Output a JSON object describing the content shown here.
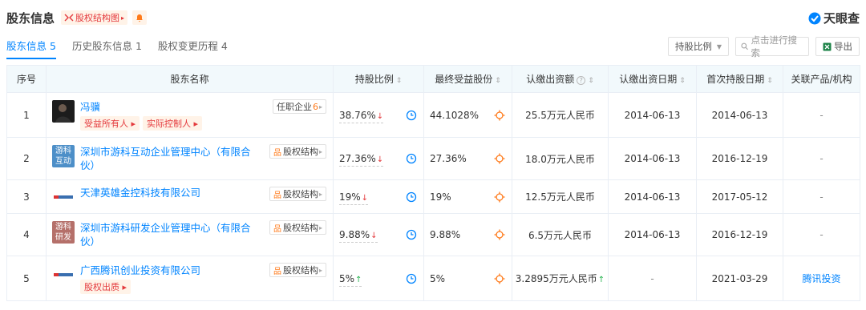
{
  "header": {
    "title": "股东信息",
    "equity_chart_label": "股权结构图",
    "brand": "天眼查"
  },
  "tabs": [
    {
      "label": "股东信息",
      "count": "5",
      "active": true
    },
    {
      "label": "历史股东信息",
      "count": "1",
      "active": false
    },
    {
      "label": "股权变更历程",
      "count": "4",
      "active": false
    }
  ],
  "toolbar": {
    "sort_label": "持股比例",
    "search_placeholder": "点击进行搜索",
    "export_label": "导出"
  },
  "table": {
    "columns": [
      "序号",
      "股东名称",
      "持股比例",
      "最终受益股份",
      "认缴出资额",
      "认缴出资日期",
      "首次持股日期",
      "关联产品/机构"
    ],
    "rows": [
      {
        "index": "1",
        "name": "冯骥",
        "logo": "person-photo",
        "logo_text": "",
        "tags": [
          "受益所有人",
          "实际控制人"
        ],
        "action": "任职企业",
        "action_count": "6",
        "share": "38.76%",
        "trend": "down",
        "benefit": "44.1028%",
        "amount": "25.5万元人民币",
        "subscribe_date": "2014-06-13",
        "first_date": "2014-06-13",
        "related": "-"
      },
      {
        "index": "2",
        "name": "深圳市游科互动企业管理中心（有限合伙）",
        "logo": "text-logo",
        "logo_text": "游科互动",
        "tags": [],
        "action": "股权结构",
        "action_count": "",
        "share": "27.36%",
        "trend": "down",
        "benefit": "27.36%",
        "amount": "18.0万元人民币",
        "subscribe_date": "2014-06-13",
        "first_date": "2016-12-19",
        "related": "-"
      },
      {
        "index": "3",
        "name": "天津英雄金控科技有限公司",
        "logo": "tiny-logo",
        "logo_text": "",
        "tags": [],
        "action": "股权结构",
        "action_count": "",
        "share": "19%",
        "trend": "down",
        "benefit": "19%",
        "amount": "12.5万元人民币",
        "subscribe_date": "2014-06-13",
        "first_date": "2017-05-12",
        "related": "-"
      },
      {
        "index": "4",
        "name": "深圳市游科研发企业管理中心（有限合伙）",
        "logo": "text-logo",
        "logo_text": "游科研发",
        "tags": [],
        "action": "股权结构",
        "action_count": "",
        "share": "9.88%",
        "trend": "down",
        "benefit": "9.88%",
        "amount": "6.5万元人民币",
        "subscribe_date": "2014-06-13",
        "first_date": "2016-12-19",
        "related": "-"
      },
      {
        "index": "5",
        "name": "广西腾讯创业投资有限公司",
        "logo": "tiny-logo",
        "logo_text": "",
        "tags": [
          "股权出质"
        ],
        "action": "股权结构",
        "action_count": "",
        "share": "5%",
        "trend": "up",
        "benefit": "5%",
        "amount": "3.2895万元人民币",
        "amount_trend": "up",
        "subscribe_date": "-",
        "first_date": "2021-03-29",
        "related": "腾讯投资"
      }
    ]
  },
  "colors": {
    "accent": "#0084ff",
    "red": "#e4393c",
    "green": "#22b14c",
    "header_bg": "#f2f9fc",
    "logo_teal": "#4d8fc8",
    "logo_brown": "#b5706a"
  }
}
